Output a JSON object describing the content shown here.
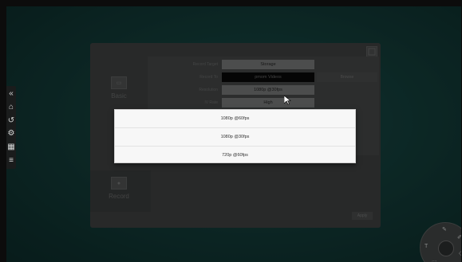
{
  "settings": {
    "rows": [
      {
        "label": "Record Target",
        "value": "Storage"
      },
      {
        "label": "Record To",
        "value": "pmom Videos",
        "button": "Browse"
      },
      {
        "label": "Resolution",
        "value": "1080p @30fps"
      },
      {
        "label": "IV Rate",
        "value": "High"
      }
    ],
    "nav": [
      {
        "label": "Basic",
        "icon": "monitor-icon"
      },
      {
        "label": "Record",
        "icon": "record-icon"
      }
    ],
    "apply_label": "Apply"
  },
  "dropdown": {
    "options": [
      "1080p @60fps",
      "1080p @30fps",
      "720p @60fps"
    ]
  },
  "toolbar": {
    "icons": [
      "collapse-left-icon",
      "home-icon",
      "undo-icon",
      "settings-icon",
      "apps-icon",
      "annotate-icon"
    ]
  }
}
